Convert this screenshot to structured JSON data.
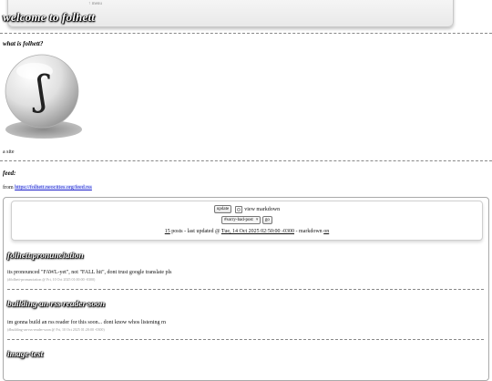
{
  "header": {
    "menu_label": "↑ menu",
    "site_title": "welcome to folhett"
  },
  "about": {
    "heading": "what is folhett?",
    "logo_glyph": "ʃ",
    "caption": "a site"
  },
  "feed_section": {
    "heading": "feed:",
    "from_label": "from",
    "feed_url": "https://folhett.neocities.org/feed.rss"
  },
  "controls": {
    "update_button": "update",
    "view_markdown_label": "view markdown",
    "post_select_value": "#sorry-bad-post",
    "go_button": "go",
    "post_count": "15",
    "posts_label": "posts - last updated @",
    "last_updated": "Tue, 14 Oct 2025 02:50:00 -0300",
    "markdown_label": "- markdown",
    "markdown_state": "on"
  },
  "posts": [
    {
      "title": "folhett pronunciation",
      "body": "its pronounced \"FAWL-yet\", not \"FALL hit\", dont trust google translate pls",
      "meta": "(#folhett-pronunciation @ Fri, 10 Oct 2025 01:00:00 -0300)"
    },
    {
      "title": "building an rss reader soon",
      "body": "im gonna build an rss reader for this soon... dont know whos listening rn",
      "meta": "(#building-an-rss-reader-soon @ Fri, 10 Oct 2025 01:20:00 -0300)"
    },
    {
      "title": "image test",
      "body": "",
      "meta": ""
    }
  ]
}
